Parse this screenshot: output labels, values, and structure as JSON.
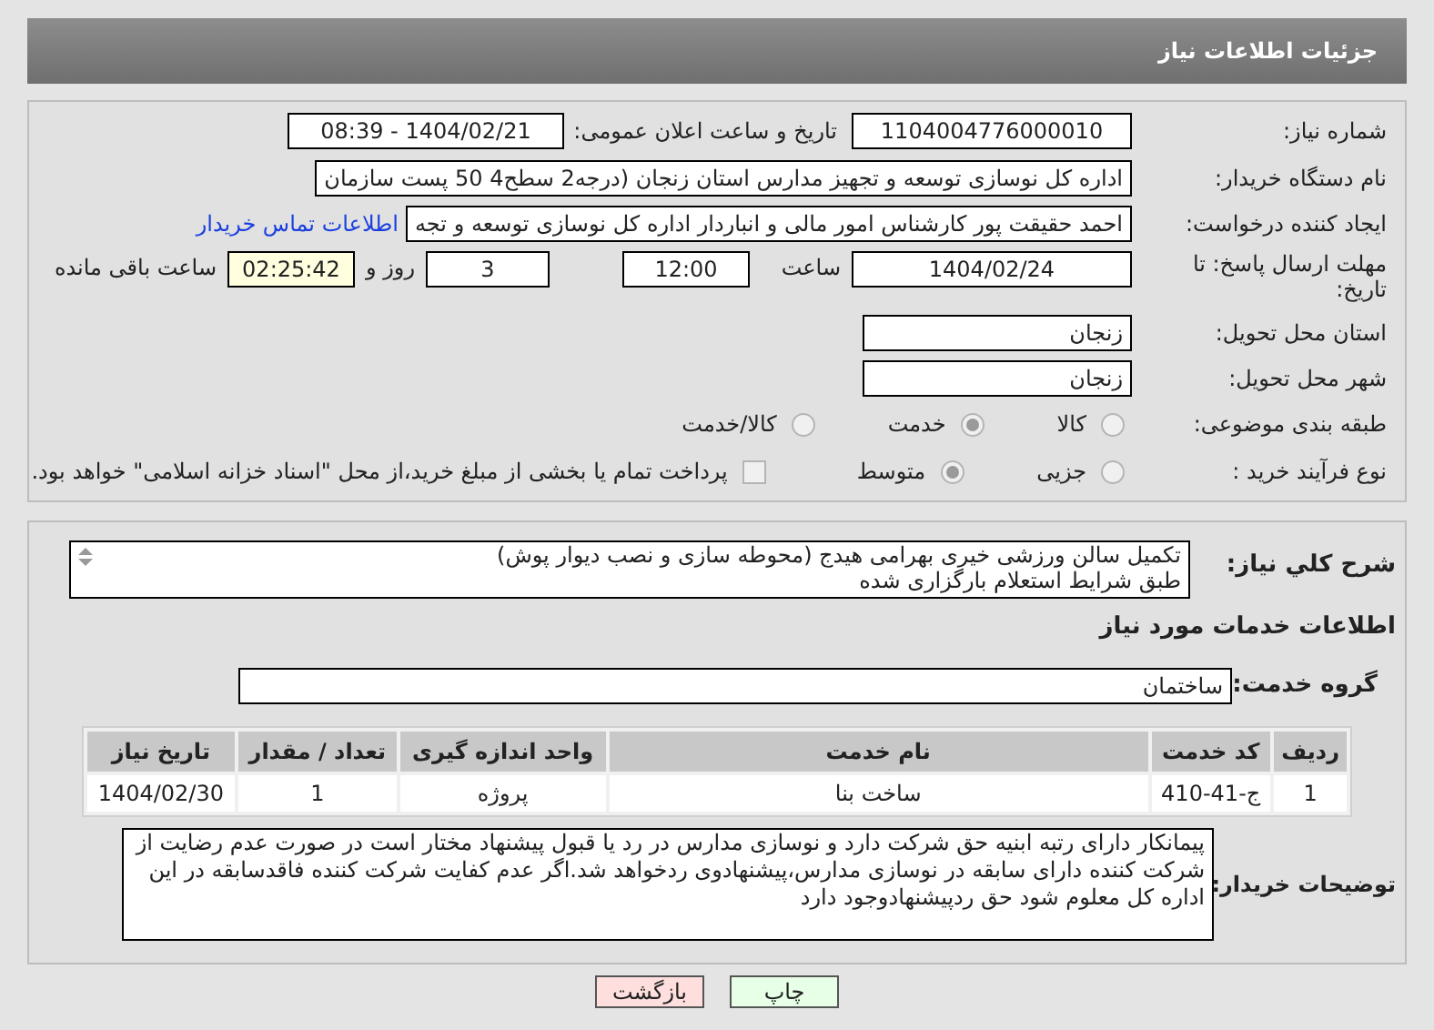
{
  "header": {
    "title": "جزئیات اطلاعات نیاز"
  },
  "need_number": {
    "label": "شماره نیاز:",
    "value": "1104004776000010"
  },
  "announce_datetime": {
    "label": "تاریخ و ساعت اعلان عمومی:",
    "value": "1404/02/21 - 08:39"
  },
  "buyer_org": {
    "label": "نام دستگاه خریدار:",
    "value": "اداره کل نوسازی   توسعه و تجهیز مدارس استان زنجان (درجه2  سطح4  50 پست سازمان"
  },
  "requester": {
    "label": "ایجاد کننده درخواست:",
    "value": "احمد حقیقت پور کارشناس امور مالی و انباردار اداره کل نوسازی   توسعه و تجه",
    "link": "اطلاعات تماس خریدار"
  },
  "deadline": {
    "label": "مهلت ارسال پاسخ: تا تاریخ:",
    "date": "1404/02/24",
    "time_label": "ساعت",
    "time": "12:00",
    "days": "3",
    "days_label": "روز و",
    "remaining": "02:25:42",
    "remaining_label": "ساعت باقی مانده"
  },
  "province": {
    "label": "استان محل تحویل:",
    "value": "زنجان"
  },
  "city": {
    "label": "شهر محل تحویل:",
    "value": "زنجان"
  },
  "category": {
    "label": "طبقه بندی موضوعی:",
    "options": [
      {
        "label": "کالا",
        "selected": false
      },
      {
        "label": "خدمت",
        "selected": true
      },
      {
        "label": "کالا/خدمت",
        "selected": false
      }
    ]
  },
  "purchase_type": {
    "label": "نوع فرآیند خرید :",
    "options": [
      {
        "label": "جزیی",
        "selected": false
      },
      {
        "label": "متوسط",
        "selected": true
      }
    ],
    "payment_checkbox": {
      "label": "پرداخت تمام یا بخشی از مبلغ خرید،از محل \"اسناد خزانه اسلامی\" خواهد بود.",
      "checked": false
    }
  },
  "description": {
    "label": "شرح کلي نياز:",
    "lines": [
      "تکمیل سالن ورزشی خیری بهرامی هیدج (محوطه سازی و نصب دیوار پوش)",
      "طبق شرایط استعلام بارگزاری شده"
    ]
  },
  "services_title": "اطلاعات خدمات مورد نیاز",
  "service_group": {
    "label": "گروه خدمت:",
    "value": "ساختمان"
  },
  "table": {
    "columns": [
      "ردیف",
      "کد خدمت",
      "نام خدمت",
      "واحد اندازه گیری",
      "تعداد / مقدار",
      "تاریخ نیاز"
    ],
    "rows": [
      [
        "1",
        "ج-41-410",
        "ساخت بنا",
        "پروژه",
        "1",
        "1404/02/30"
      ]
    ]
  },
  "buyer_notes": {
    "label": "توضیحات خریدار:",
    "value": "پیمانکار دارای رتبه ابنیه حق شرکت دارد و نوسازی مدارس در رد یا قبول پیشنهاد مختار است در صورت عدم رضایت از شرکت کننده دارای سابقه در نوسازی مدارس،پیشنهادوی ردخواهد شد.اگر عدم کفایت شرکت کننده فاقدسابقه در این اداره کل معلوم شود حق ردپیشنهادوجود دارد"
  },
  "buttons": [
    {
      "label": "چاپ",
      "kind": "print"
    },
    {
      "label": "بازگشت",
      "kind": "back"
    }
  ]
}
